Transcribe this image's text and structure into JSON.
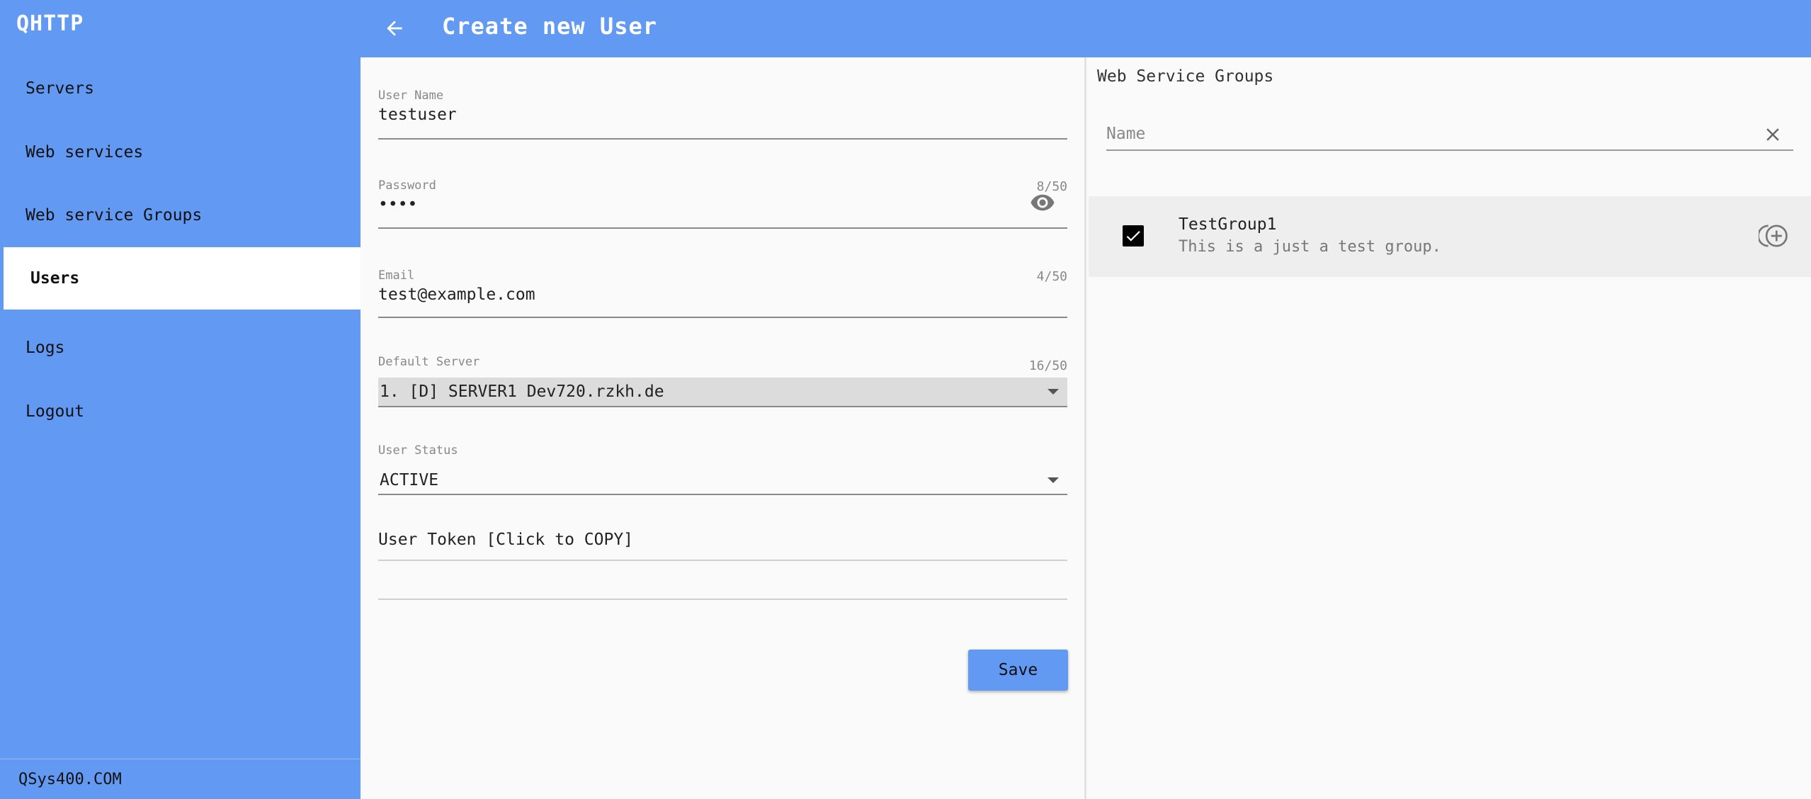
{
  "app": {
    "brand": "QHTTP",
    "footer": "QSys400.COM"
  },
  "sidebar": {
    "items": [
      {
        "label": "Servers",
        "active": false
      },
      {
        "label": "Web services",
        "active": false
      },
      {
        "label": "Web service Groups",
        "active": false
      },
      {
        "label": "Users",
        "active": true
      },
      {
        "label": "Logs",
        "active": false
      },
      {
        "label": "Logout",
        "active": false
      }
    ]
  },
  "header": {
    "title": "Create new User",
    "back_icon": "arrow-left-icon"
  },
  "form": {
    "username": {
      "label": "User Name",
      "value": "testuser",
      "counter": "8/50"
    },
    "password": {
      "label": "Password",
      "value": "••••",
      "counter": "4/50",
      "icon": "eye-icon"
    },
    "email": {
      "label": "Email",
      "value": "test@example.com",
      "counter": "16/50"
    },
    "default_server": {
      "label": "Default Server",
      "value": "1. [D] SERVER1 Dev720.rzkh.de"
    },
    "user_status": {
      "label": "User Status",
      "value": "ACTIVE"
    },
    "user_token": {
      "label": "User Token [Click to COPY]",
      "value": ""
    },
    "save_label": "Save"
  },
  "groups_panel": {
    "title": "Web Service Groups",
    "filter": {
      "placeholder": "Name",
      "value": ""
    },
    "groups": [
      {
        "name": "TestGroup1",
        "description": "This is a just a test group.",
        "checked": true
      }
    ]
  },
  "colors": {
    "primary": "#6299f2",
    "active_item": "#ffffff",
    "row_bg": "#eeeeee"
  }
}
